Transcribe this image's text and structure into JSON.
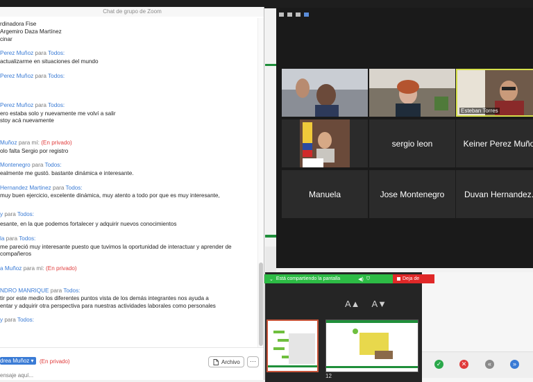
{
  "chat": {
    "title": "Chat de grupo de Zoom",
    "messages": [
      {
        "type": "text",
        "text": "rdinadora Fise"
      },
      {
        "type": "text",
        "text": "Argemiro Daza Martínez"
      },
      {
        "type": "text",
        "text": "cinar"
      },
      {
        "type": "header",
        "name": "Perez Muñoz",
        "para": "para",
        "to": "Todos:"
      },
      {
        "type": "text",
        "text": "actualizarme en situaciones del mundo"
      },
      {
        "type": "header",
        "name": "Perez Muñoz",
        "para": "para",
        "to": "Todos:"
      },
      {
        "type": "header",
        "name": "Perez Muñoz",
        "para": "para",
        "to": "Todos:"
      },
      {
        "type": "text",
        "text": "ero estaba solo y nuevamente me volví a salir"
      },
      {
        "type": "text",
        "text": "stoy acá nuevamente"
      },
      {
        "type": "header",
        "name": "Muñoz",
        "para": "para mí:",
        "priv": "(En privado)"
      },
      {
        "type": "text",
        "text": "olo falta Sergio por registro"
      },
      {
        "type": "header",
        "name": "Montenegro",
        "para": "para",
        "to": "Todos:"
      },
      {
        "type": "text",
        "text": "ealmente me gustó. bastante dinámica e interesante."
      },
      {
        "type": "header",
        "name": "Hernandez Martinez",
        "para": "para",
        "to": "Todos:"
      },
      {
        "type": "text",
        "text": "muy buen ejercicio, excelente dinámica, muy atento a todo por que es muy interesante,"
      },
      {
        "type": "header",
        "name": "y",
        "para": "para",
        "to": "Todos:"
      },
      {
        "type": "text",
        "text": "esante, en la que podemos fortalecer y adquirir nuevos conocimientos"
      },
      {
        "type": "header",
        "name": "la",
        "para": "para",
        "to": "Todos:"
      },
      {
        "type": "text",
        "text": "me pareció muy interesante puesto que tuvimos la oportunidad de interactuar  y aprender de"
      },
      {
        "type": "text",
        "text": "compañeros"
      },
      {
        "type": "header",
        "name": "a Muñoz",
        "para": "para mí:",
        "priv": "(En privado)"
      },
      {
        "type": "header",
        "name": "NDRO MANRIQUE",
        "para": "para",
        "to": "Todos:"
      },
      {
        "type": "text",
        "text": "tir por este medio los diferentes puntos vista de los demás integrantes nos ayuda a"
      },
      {
        "type": "text",
        "text": "entar y adquirir otra perspectiva para nuestras actividades laborales como personales"
      },
      {
        "type": "header",
        "name": "y",
        "para": "para",
        "to": "Todos:"
      }
    ],
    "to_label": "drea Muñoz",
    "to_private": "(En privado)",
    "file_button": "Archivo",
    "more_button": "···",
    "input_placeholder": "ensaje aquí..."
  },
  "video": {
    "tiles": [
      {
        "name": "",
        "kind": "video"
      },
      {
        "name": "",
        "kind": "video"
      },
      {
        "name": "Esteban Torres",
        "kind": "video",
        "active": true
      },
      {
        "name": "",
        "kind": "video"
      },
      {
        "name": "sergio leon",
        "kind": "name"
      },
      {
        "name": "Keiner Perez Muño",
        "kind": "name"
      },
      {
        "name": "Manuela",
        "kind": "name"
      },
      {
        "name": "Jose Montenegro",
        "kind": "name"
      },
      {
        "name": "Duvan Hernandez.",
        "kind": "name"
      }
    ]
  },
  "share": {
    "status": "Está compartiendo la pantalla",
    "stop": "Deja de"
  },
  "ppt": {
    "font_up": "A▲",
    "font_down": "A▼",
    "slide_number": "12"
  },
  "colors": {
    "accent_blue": "#3a7bd5",
    "private_red": "#e03b3b",
    "share_green": "#2dbb45",
    "stop_red": "#e02828",
    "active_border": "#d6e04a"
  }
}
